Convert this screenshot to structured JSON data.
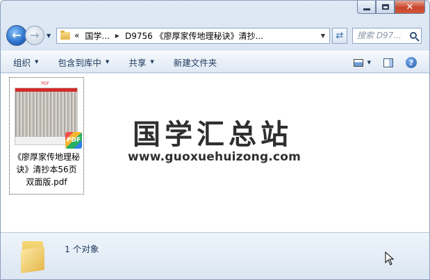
{
  "window": {
    "caption_buttons": {
      "minimize": "minimize-icon",
      "maximize": "maximize-icon",
      "close": "close-icon"
    }
  },
  "nav": {
    "back_icon": "back-arrow-icon",
    "forward_icon": "forward-arrow-icon",
    "breadcrumb": {
      "overflow": "«",
      "items": [
        "国学...",
        "D9756 《廖厚家传地理秘诀》清抄..."
      ]
    },
    "search_placeholder": "搜索 D97..."
  },
  "toolbar": {
    "organize": "组织",
    "include_in_library": "包含到库中",
    "share": "共享",
    "new_folder": "新建文件夹"
  },
  "content": {
    "file": {
      "name": "《廖厚家传地理秘诀》清抄本56页双面版.pdf",
      "name_lines": "《廖厚家传地理秘\n诀》清抄本56页\n双面版.pdf",
      "badge": "PDF",
      "thumb_mark": "PDF"
    },
    "watermark": {
      "title": "国学汇总站",
      "url": "www.guoxuehuizong.com"
    }
  },
  "status": {
    "text": "1 个对象"
  },
  "colors": {
    "accent": "#1e395b",
    "pdf_red": "#d42a2a",
    "folder": "#e6b94c"
  }
}
